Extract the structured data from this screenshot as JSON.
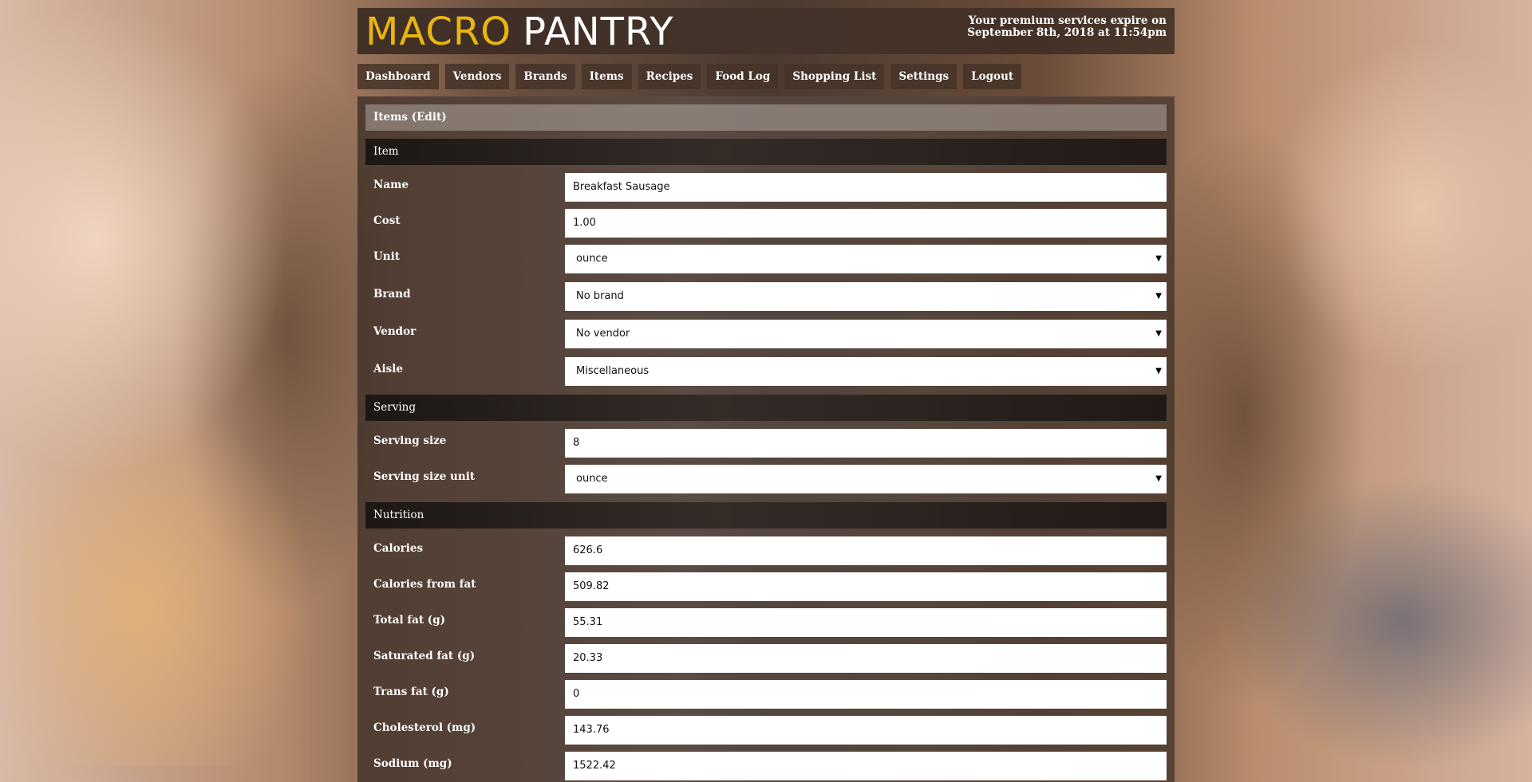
{
  "header": {
    "logo_macro": "MACRO",
    "logo_pantry": "PANTRY",
    "expire_line1": "Your premium services expire on",
    "expire_line2": "September 8th, 2018 at 11:54pm"
  },
  "nav": [
    "Dashboard",
    "Vendors",
    "Brands",
    "Items",
    "Recipes",
    "Food Log",
    "Shopping List",
    "Settings",
    "Logout"
  ],
  "page_title": "Items (Edit)",
  "sections": {
    "item": "Item",
    "serving": "Serving",
    "nutrition": "Nutrition"
  },
  "item_fields": {
    "name": {
      "label": "Name",
      "value": "Breakfast Sausage"
    },
    "cost": {
      "label": "Cost",
      "value": "1.00"
    },
    "unit": {
      "label": "Unit",
      "value": "ounce"
    },
    "brand": {
      "label": "Brand",
      "value": "No brand"
    },
    "vendor": {
      "label": "Vendor",
      "value": "No vendor"
    },
    "aisle": {
      "label": "Aisle",
      "value": "Miscellaneous"
    }
  },
  "serving_fields": {
    "serving_size": {
      "label": "Serving size",
      "value": "8"
    },
    "serving_size_unit": {
      "label": "Serving size unit",
      "value": "ounce"
    }
  },
  "nutrition_fields": {
    "calories": {
      "label": "Calories",
      "value": "626.6"
    },
    "calories_from_fat": {
      "label": "Calories from fat",
      "value": "509.82"
    },
    "total_fat": {
      "label": "Total fat (g)",
      "value": "55.31"
    },
    "saturated_fat": {
      "label": "Saturated fat (g)",
      "value": "20.33"
    },
    "trans_fat": {
      "label": "Trans fat (g)",
      "value": "0"
    },
    "cholesterol": {
      "label": "Cholesterol (mg)",
      "value": "143.76"
    },
    "sodium": {
      "label": "Sodium (mg)",
      "value": "1522.42"
    }
  },
  "icons": {
    "select_caret": "caret-down-icon"
  },
  "colors": {
    "logo_accent": "#e8b511"
  }
}
